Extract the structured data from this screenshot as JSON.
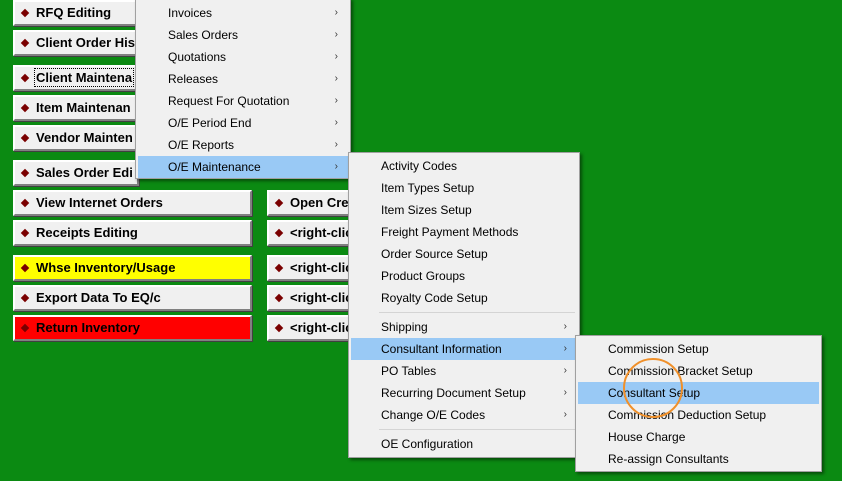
{
  "left_buttons": [
    {
      "label": "RFQ Editing"
    },
    {
      "label": "Client Order His"
    },
    {
      "label": "Client Maintena"
    },
    {
      "label": "Item Maintenan"
    },
    {
      "label": "Vendor Mainten"
    },
    {
      "label": "Sales Order Edi"
    },
    {
      "label": "View Internet Orders"
    },
    {
      "label": "Receipts Editing"
    },
    {
      "label": "Whse Inventory/Usage",
      "color": "#ffff00"
    },
    {
      "label": "Export Data To EQ/c"
    },
    {
      "label": "Return Inventory",
      "color": "#ff0000"
    }
  ],
  "right_buttons": [
    {
      "label": "Open Cre"
    },
    {
      "label": "<right-clic"
    },
    {
      "label": "<right-clic"
    },
    {
      "label": "<right-clic"
    },
    {
      "label": "<right-clic"
    }
  ],
  "menu_main": [
    {
      "label": "Invoices",
      "submenu": true
    },
    {
      "label": "Sales Orders",
      "submenu": true
    },
    {
      "label": "Quotations",
      "submenu": true
    },
    {
      "label": "Releases",
      "submenu": true
    },
    {
      "label": "Request For Quotation",
      "submenu": true
    },
    {
      "label": "O/E Period End",
      "submenu": true
    },
    {
      "label": "O/E Reports",
      "submenu": true
    },
    {
      "label": "O/E Maintenance",
      "submenu": true,
      "highlighted": true
    }
  ],
  "menu_oe_maintenance": [
    {
      "label": "Activity Codes"
    },
    {
      "label": "Item Types Setup"
    },
    {
      "label": "Item Sizes Setup"
    },
    {
      "label": "Freight Payment Methods"
    },
    {
      "label": "Order Source Setup"
    },
    {
      "label": "Product Groups"
    },
    {
      "label": "Royalty Code Setup"
    },
    {
      "label": "Shipping",
      "submenu": true
    },
    {
      "label": "Consultant Information",
      "submenu": true,
      "highlighted": true
    },
    {
      "label": "PO Tables",
      "submenu": true
    },
    {
      "label": "Recurring Document Setup",
      "submenu": true
    },
    {
      "label": "Change O/E Codes",
      "submenu": true
    },
    {
      "label": "OE Configuration"
    }
  ],
  "menu_consultant": [
    {
      "label": "Commission Setup"
    },
    {
      "label": "Commission Bracket Setup"
    },
    {
      "label": "Consultant Setup",
      "highlighted": true
    },
    {
      "label": "Commission Deduction Setup"
    },
    {
      "label": "House Charge"
    },
    {
      "label": "Re-assign Consultants"
    }
  ],
  "colors": {
    "background": "#0b8a12",
    "highlight": "#99c9f5",
    "annotation_circle": "#f0902a"
  }
}
